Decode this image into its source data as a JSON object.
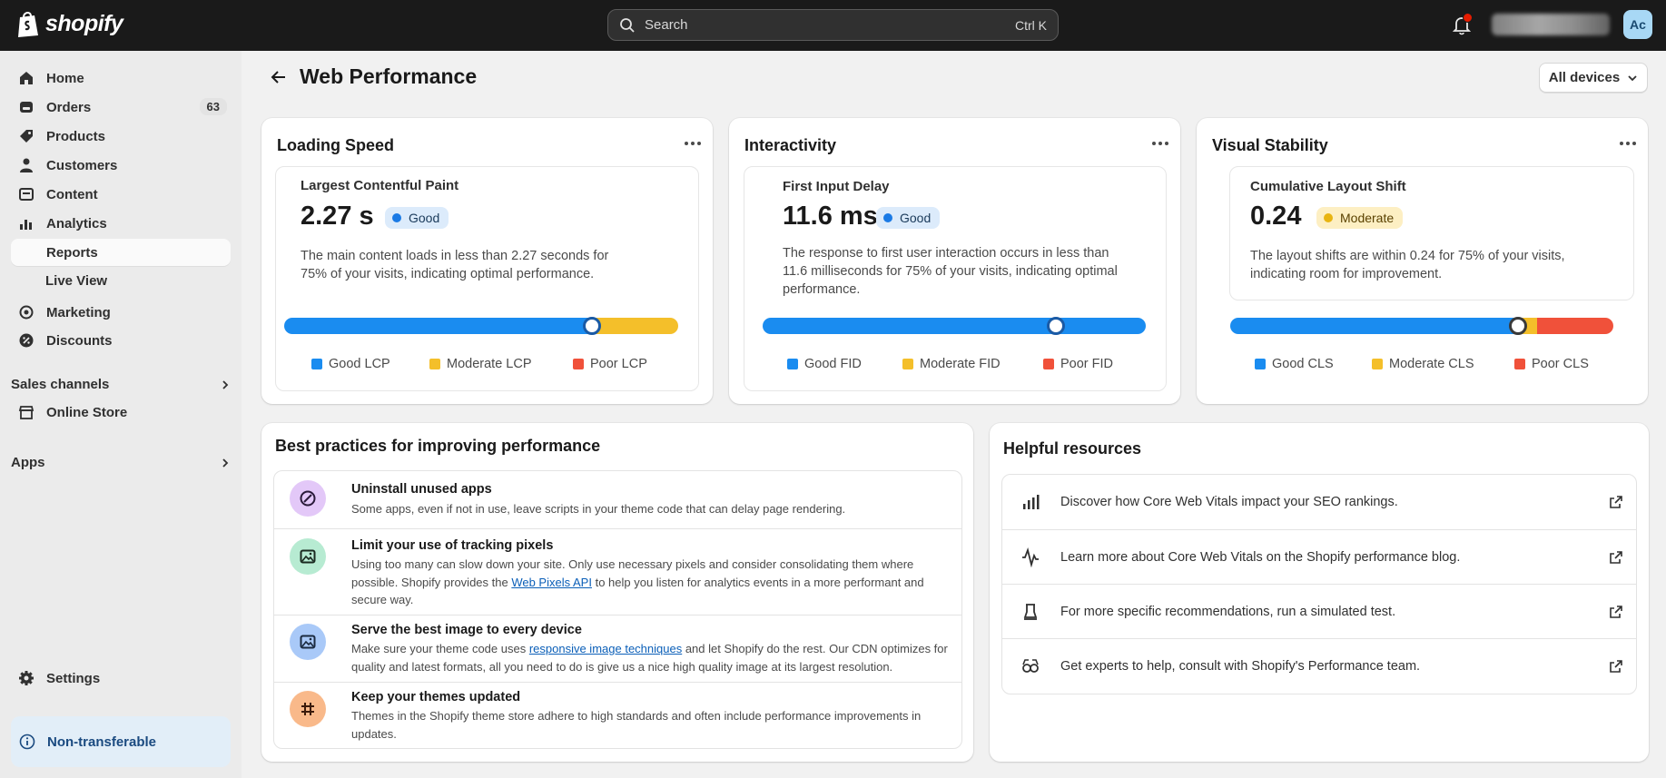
{
  "topbar": {
    "brand": "shopify",
    "search_placeholder": "Search",
    "search_shortcut": "Ctrl K",
    "avatar_initials": "Ac"
  },
  "sidebar": {
    "items": [
      {
        "label": "Home",
        "icon": "home-icon"
      },
      {
        "label": "Orders",
        "icon": "orders-icon",
        "badge": "63"
      },
      {
        "label": "Products",
        "icon": "tag-icon"
      },
      {
        "label": "Customers",
        "icon": "person-icon"
      },
      {
        "label": "Content",
        "icon": "content-icon"
      },
      {
        "label": "Analytics",
        "icon": "bar-chart-icon"
      },
      {
        "label": "Reports",
        "icon": "",
        "active": true
      }
    ],
    "live_view": "Live View",
    "items2": [
      {
        "label": "Marketing",
        "icon": "target-icon"
      },
      {
        "label": "Discounts",
        "icon": "discount-icon"
      }
    ],
    "sales_channels": "Sales channels",
    "online_store": "Online Store",
    "apps": "Apps",
    "settings": "Settings",
    "non_transferable": "Non-transferable"
  },
  "page": {
    "title": "Web Performance",
    "devices": "All devices"
  },
  "cards": [
    {
      "title": "Loading Speed",
      "metric": "Largest Contentful Paint",
      "value": "2.27 s",
      "status": "Good",
      "status_kind": "good",
      "description": "The main content loads in less than 2.27 seconds for 75% of your visits, indicating optimal performance.",
      "bar": {
        "good_fraction": 0.78,
        "moderate_fraction": 0.22,
        "poor_fraction": 0.0,
        "marker_fraction": 0.78
      },
      "legend": [
        "Good LCP",
        "Moderate LCP",
        "Poor LCP"
      ]
    },
    {
      "title": "Interactivity",
      "metric": "First Input Delay",
      "value": "11.6 ms",
      "status": "Good",
      "status_kind": "good",
      "description": "The response to first user interaction occurs in less than 11.6 milliseconds for 75% of your visits, indicating optimal performance.",
      "bar": {
        "good_fraction": 1.0,
        "moderate_fraction": 0.0,
        "poor_fraction": 0.0,
        "marker_fraction": 0.765
      },
      "legend": [
        "Good FID",
        "Moderate FID",
        "Poor FID"
      ]
    },
    {
      "title": "Visual Stability",
      "metric": "Cumulative Layout Shift",
      "value": "0.24",
      "status": "Moderate",
      "status_kind": "mod",
      "description": "The layout shifts are within 0.24 for 75% of your visits, indicating room for improvement.",
      "bar": {
        "good_fraction": 0.75,
        "moderate_fraction": 0.05,
        "poor_fraction": 0.2,
        "marker_fraction": 0.75
      },
      "legend": [
        "Good CLS",
        "Moderate CLS",
        "Poor CLS"
      ]
    }
  ],
  "colors": {
    "good": "#1a8cf0",
    "moderate": "#f4bf2a",
    "poor": "#f0513a"
  },
  "best_practices": {
    "title": "Best practices for improving performance",
    "items": [
      {
        "title": "Uninstall unused apps",
        "desc": "Some apps, even if not in use, leave scripts in your theme code that can delay page rendering.",
        "icon": "block-icon"
      },
      {
        "title": "Limit your use of tracking pixels",
        "desc_pre": "Using too many can slow down your site. Only use necessary pixels and consider consolidating them where possible. Shopify provides the ",
        "link": "Web Pixels API",
        "desc_post": " to help you listen for analytics events in a more performant and secure way.",
        "icon": "image-icon"
      },
      {
        "title": "Serve the best image to every device",
        "desc_pre": "Make sure your theme code uses ",
        "link": "responsive image techniques",
        "desc_post": " and let Shopify do the rest. Our CDN optimizes for quality and latest formats, all you need to do is give us a nice high quality image at its largest resolution.",
        "icon": "image-icon"
      },
      {
        "title": "Keep your themes updated",
        "desc": "Themes in the Shopify theme store adhere to high standards and often include performance improvements in updates.",
        "icon": "sliders-icon"
      }
    ]
  },
  "resources": {
    "title": "Helpful resources",
    "items": [
      {
        "text": "Discover how Core Web Vitals impact your SEO rankings.",
        "icon": "signal-icon"
      },
      {
        "text": "Learn more about Core Web Vitals on the Shopify performance blog.",
        "icon": "pulse-icon"
      },
      {
        "text": "For more specific recommendations, run a simulated test.",
        "icon": "test-icon"
      },
      {
        "text": "Get experts to help, consult with Shopify's Performance team.",
        "icon": "experts-icon"
      }
    ]
  }
}
